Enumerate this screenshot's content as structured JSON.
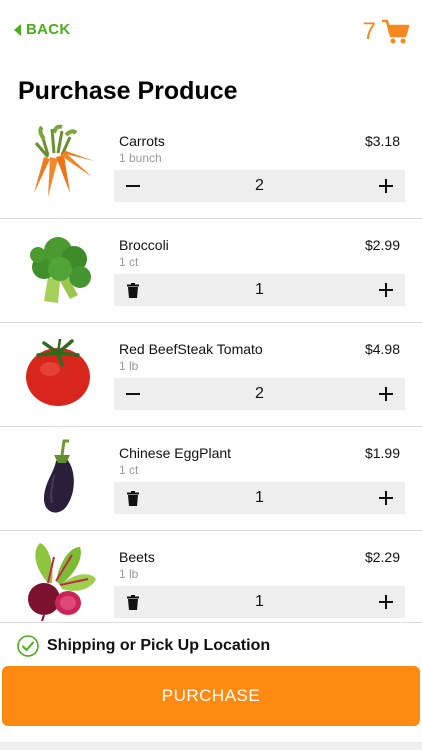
{
  "header": {
    "back_label": "BACK",
    "cart_count": "7"
  },
  "page_title": "Purchase Produce",
  "items": [
    {
      "name": "Carrots",
      "unit": "1 bunch",
      "price": "$3.18",
      "quantity": "2",
      "decrement": "minus"
    },
    {
      "name": "Broccoli",
      "unit": "1 ct",
      "price": "$2.99",
      "quantity": "1",
      "decrement": "trash"
    },
    {
      "name": "Red BeefSteak Tomato",
      "unit": "1 lb",
      "price": "$4.98",
      "quantity": "2",
      "decrement": "minus"
    },
    {
      "name": "Chinese EggPlant",
      "unit": "1 ct",
      "price": "$1.99",
      "quantity": "1",
      "decrement": "trash"
    },
    {
      "name": "Beets",
      "unit": "1 lb",
      "price": "$2.29",
      "quantity": "1",
      "decrement": "trash"
    }
  ],
  "shipping": {
    "label": "Shipping or Pick Up Location",
    "checked": true
  },
  "purchase_label": "PURCHASE",
  "colors": {
    "accent_green": "#4cad1f",
    "accent_orange": "#ff8a12",
    "cart_orange": "#f5891f"
  },
  "icons": {
    "back": "chevron-left-icon",
    "cart": "shopping-cart-icon",
    "minus": "minus-icon",
    "plus": "plus-icon",
    "trash": "trash-icon",
    "check": "check-circle-icon"
  }
}
